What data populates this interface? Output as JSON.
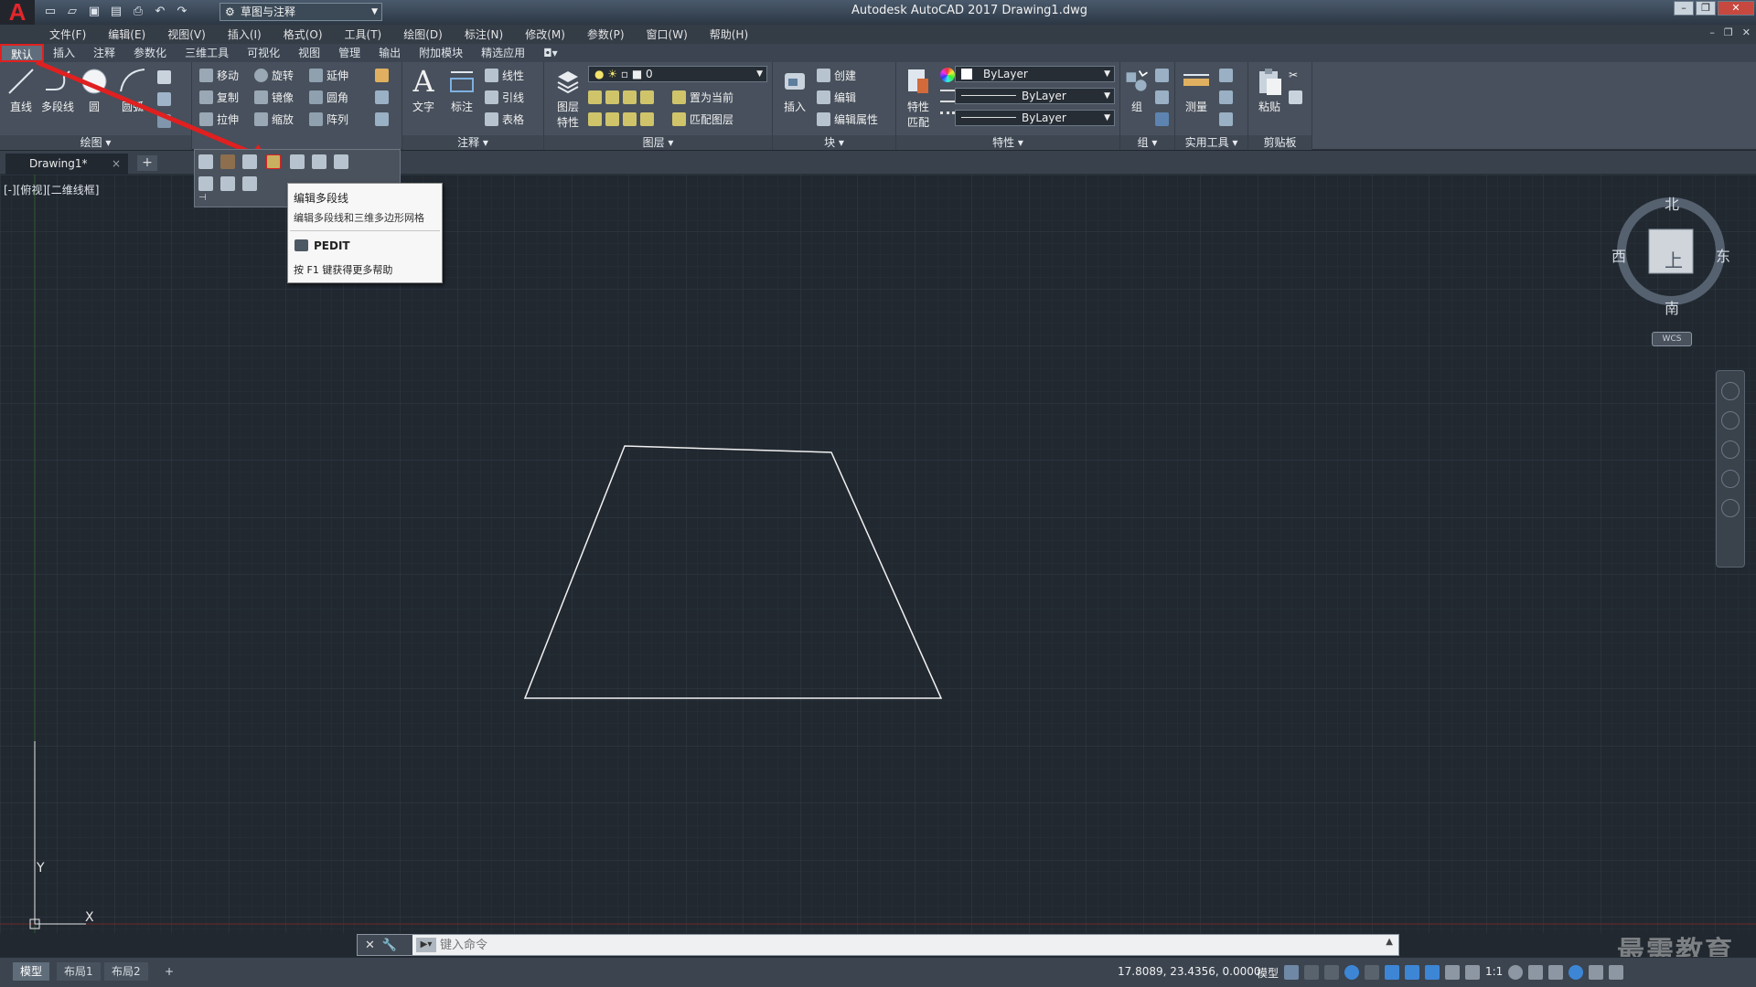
{
  "app": {
    "logo_letter": "A",
    "title": "Autodesk AutoCAD 2017    Drawing1.dwg",
    "workspace": "草图与注释"
  },
  "menu": [
    "文件(F)",
    "编辑(E)",
    "视图(V)",
    "插入(I)",
    "格式(O)",
    "工具(T)",
    "绘图(D)",
    "标注(N)",
    "修改(M)",
    "参数(P)",
    "窗口(W)",
    "帮助(H)"
  ],
  "ribbon_tabs": [
    "默认",
    "插入",
    "注释",
    "参数化",
    "三维工具",
    "可视化",
    "视图",
    "管理",
    "输出",
    "附加模块",
    "精选应用"
  ],
  "ribbon": {
    "draw": {
      "title": "绘图",
      "line": "直线",
      "polyline": "多段线",
      "circle": "圆",
      "arc": "圆弧"
    },
    "modify": {
      "move": "移动",
      "rotate": "旋转",
      "extend": "延伸",
      "copy": "复制",
      "mirror": "镜像",
      "fillet": "圆角",
      "stretch": "拉伸",
      "scale": "缩放",
      "array": "阵列"
    },
    "annotation": {
      "title": "注释",
      "text": "文字",
      "dimension": "标注",
      "linear": "线性",
      "leader": "引线",
      "table": "表格"
    },
    "layers": {
      "title": "图层",
      "layer_props_1": "图层",
      "layer_props_2": "特性",
      "current_layer": "0",
      "set_current": "置为当前",
      "match_layer": "匹配图层"
    },
    "block": {
      "title": "块",
      "insert": "插入",
      "create": "创建",
      "edit": "编辑",
      "edit_attr": "编辑属性"
    },
    "properties": {
      "title": "特性",
      "match_1": "特性",
      "match_2": "匹配",
      "color": "ByLayer",
      "linetype": "ByLayer",
      "lineweight": "ByLayer"
    },
    "groups": {
      "title": "组",
      "group": "组"
    },
    "utilities": {
      "title": "实用工具",
      "measure": "测量"
    },
    "clipboard": {
      "title": "剪贴板",
      "paste": "粘贴"
    }
  },
  "document_tab": {
    "name": "Drawing1*",
    "close": "×",
    "new": "+"
  },
  "tooltip": {
    "title": "编辑多段线",
    "description": "编辑多段线和三维多边形网格",
    "command": "PEDIT",
    "help": "按 F1 键获得更多帮助"
  },
  "viewport_label": "[-][俯视][二维线框]",
  "viewcube": {
    "north": "北",
    "south": "南",
    "east": "东",
    "west": "西",
    "face": "上",
    "wcs": "WCS"
  },
  "ucs": {
    "x": "X",
    "y": "Y"
  },
  "command_line": {
    "placeholder": "键入命令"
  },
  "layout_tabs": [
    "模型",
    "布局1",
    "布局2",
    "+"
  ],
  "status": {
    "coordinates": "17.8089, 23.4356, 0.0000",
    "model": "模型",
    "scale": "1:1"
  },
  "watermark": "最需教育",
  "colors": {
    "canvas": "#212830",
    "highlight": "#e02020",
    "ribbon": "#47505c"
  }
}
